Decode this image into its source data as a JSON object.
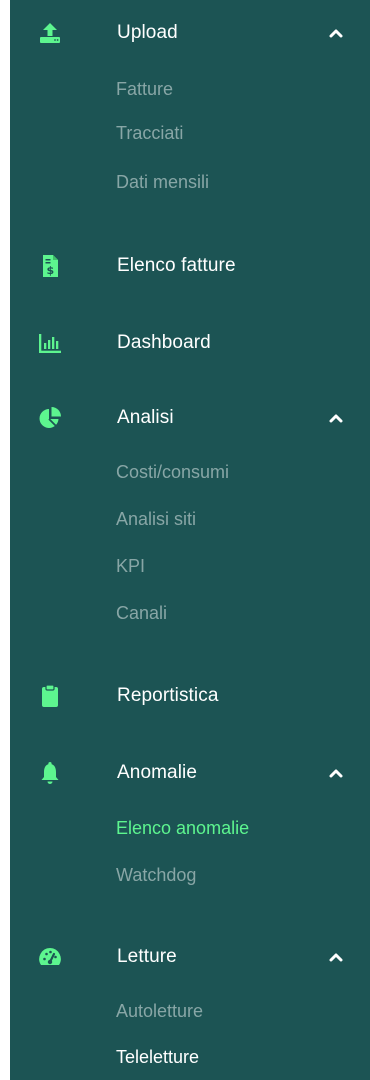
{
  "colors": {
    "sidebar_bg": "#1c5454",
    "icon": "#5df58f",
    "label": "#ffffff",
    "submenu": "#88a6a6",
    "active": "#5df58f"
  },
  "menu": {
    "upload": {
      "label": "Upload",
      "icon": "upload-icon",
      "expanded": true,
      "items": [
        "Fatture",
        "Tracciati",
        "Dati mensili"
      ]
    },
    "elenco_fatture": {
      "label": "Elenco fatture",
      "icon": "invoice-icon"
    },
    "dashboard": {
      "label": "Dashboard",
      "icon": "bar-chart-icon"
    },
    "analisi": {
      "label": "Analisi",
      "icon": "pie-chart-icon",
      "expanded": true,
      "items": [
        "Costi/consumi",
        "Analisi siti",
        "KPI",
        "Canali"
      ]
    },
    "reportistica": {
      "label": "Reportistica",
      "icon": "clipboard-icon"
    },
    "anomalie": {
      "label": "Anomalie",
      "icon": "bell-icon",
      "expanded": true,
      "items": [
        "Elenco anomalie",
        "Watchdog"
      ],
      "active_item": "Elenco anomalie"
    },
    "letture": {
      "label": "Letture",
      "icon": "gauge-icon",
      "expanded": true,
      "items": [
        "Autoletture",
        "Teleletture"
      ],
      "highlighted_item": "Teleletture"
    }
  }
}
